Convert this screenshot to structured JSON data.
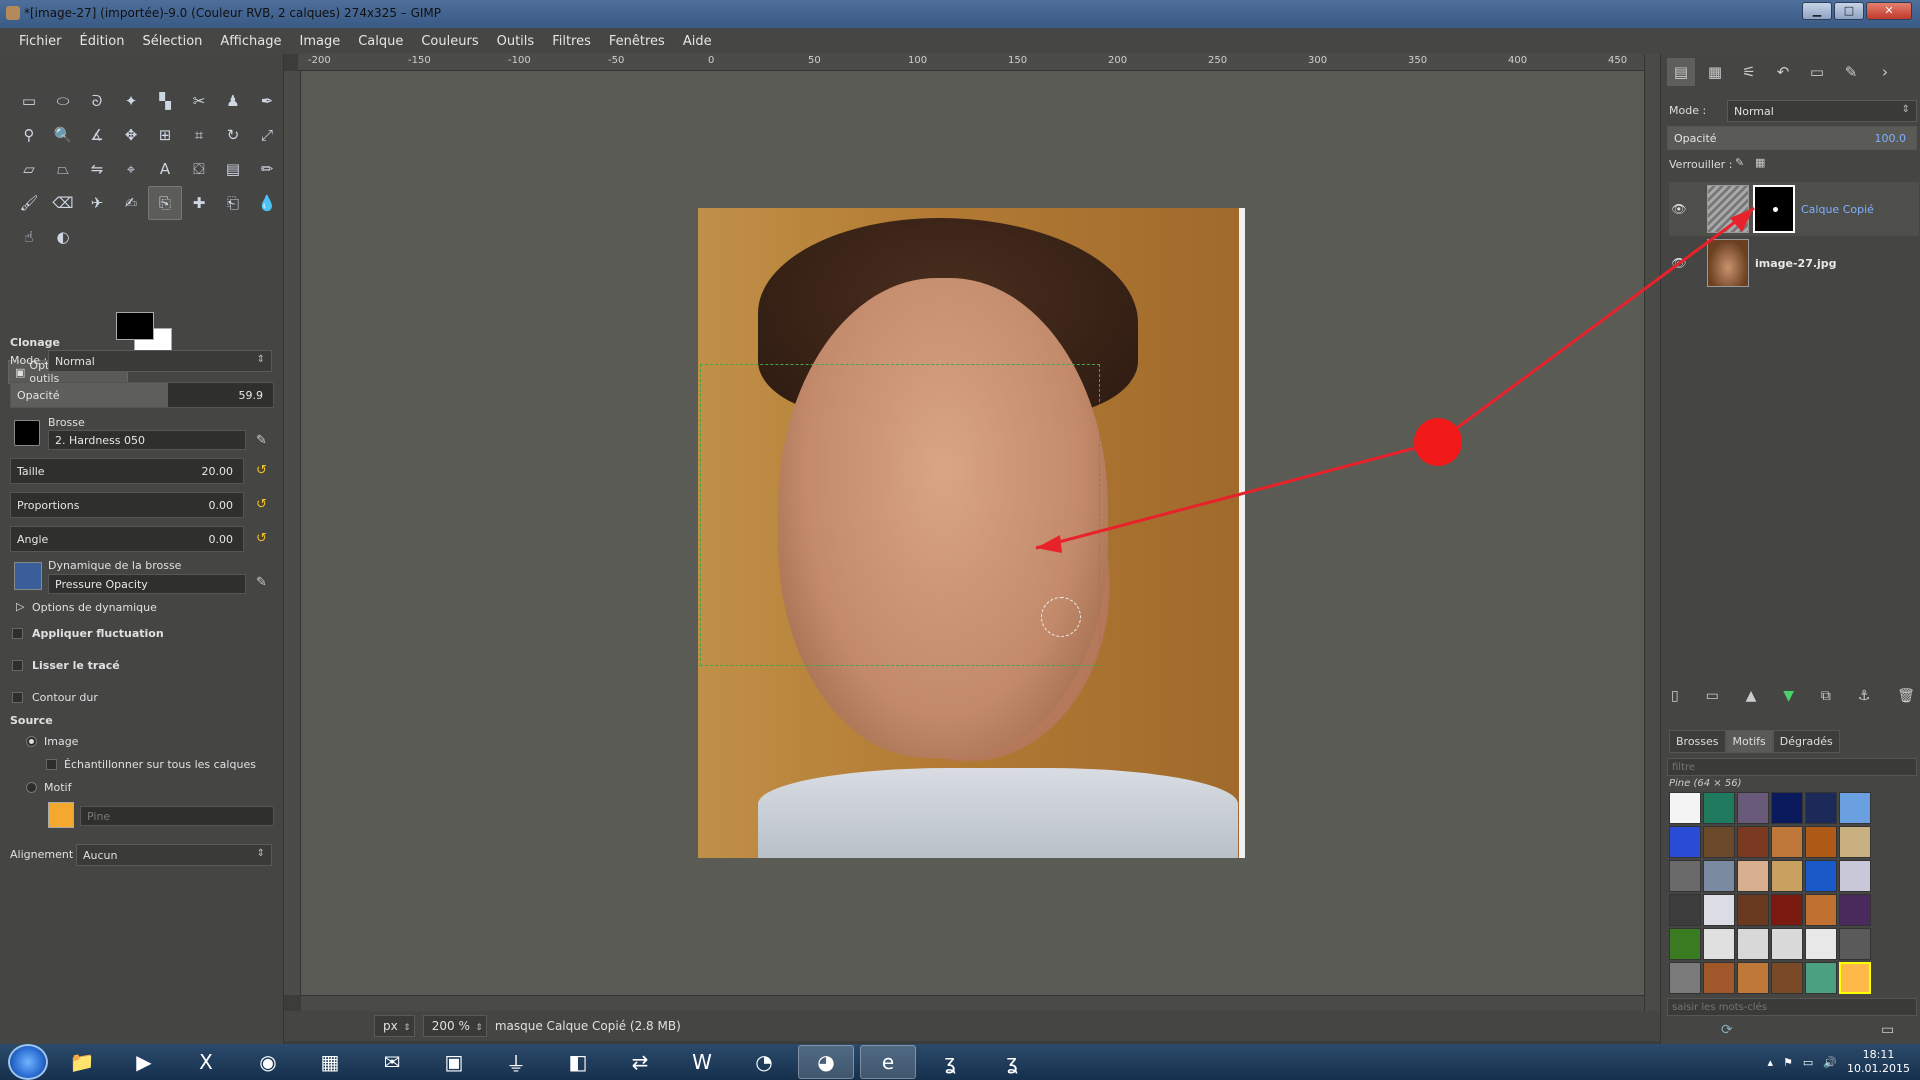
{
  "window": {
    "title": "*[image-27] (importée)-9.0 (Couleur RVB, 2 calques) 274x325 – GIMP",
    "minimize_label": "▁",
    "maximize_label": "□",
    "close_label": "✕"
  },
  "menu": [
    "Fichier",
    "Édition",
    "Sélection",
    "Affichage",
    "Image",
    "Calque",
    "Couleurs",
    "Outils",
    "Filtres",
    "Fenêtres",
    "Aide"
  ],
  "ruler_labels": [
    "-200",
    "-150",
    "-100",
    "-50",
    "0",
    "50",
    "100",
    "150",
    "200",
    "250",
    "300",
    "350",
    "400",
    "450"
  ],
  "tool_options": {
    "tab_label": "Options des outils",
    "tool_name": "Clonage",
    "mode_label": "Mode :",
    "mode_value": "Normal",
    "opacity_label": "Opacité",
    "opacity_value": "59.9",
    "opacity_fraction": 0.599,
    "brush_label": "Brosse",
    "brush_value": "2. Hardness 050",
    "size_label": "Taille",
    "size_value": "20.00",
    "proportions_label": "Proportions",
    "proportions_value": "0.00",
    "angle_label": "Angle",
    "angle_value": "0.00",
    "dynamics_label": "Dynamique de la brosse",
    "dynamics_value": "Pressure Opacity",
    "dynamics_options": "Options de dynamique",
    "apply_jitter": "Appliquer fluctuation",
    "smooth_stroke": "Lisser le tracé",
    "hard_edge": "Contour dur",
    "source_label": "Source",
    "source_image": "Image",
    "sample_merged": "Échantillonner sur tous les calques",
    "source_pattern": "Motif",
    "pattern_name": "Pine",
    "alignment_label": "Alignement :",
    "alignment_value": "Aucun"
  },
  "status": {
    "unit": "px",
    "zoom": "200 %",
    "message": "masque Calque Copié (2.8 MB)"
  },
  "layers_panel": {
    "mode_label": "Mode :",
    "mode_value": "Normal",
    "opacity_label": "Opacité",
    "opacity_value": "100.0",
    "lock_label": "Verrouiller :",
    "layers": [
      {
        "name": "Calque Copié"
      },
      {
        "name": "image-27.jpg"
      }
    ]
  },
  "resources": {
    "tabs": [
      "Brosses",
      "Motifs",
      "Dégradés"
    ],
    "filter_placeholder": "filtre",
    "selected_pattern": "Pine (64 × 56)",
    "tags_placeholder": "saisir les mots-clés",
    "pattern_colors": [
      "#f4f4f4",
      "#1f7a5e",
      "#6a5a7a",
      "#0b1a5c",
      "#1c2a5a",
      "#6aa0e0",
      "#2a4bd6",
      "#6b4a2c",
      "#7a3a22",
      "#c0783a",
      "#b05a18",
      "#c8b080",
      "#6a6a6a",
      "#7a8aa0",
      "#d8b090",
      "#c8a060",
      "#1a5ac8",
      "#c8c8d8",
      "#3c3c3c",
      "#dcdce4",
      "#6a3a20",
      "#7a1a10",
      "#c07030",
      "#4a2a5c",
      "#3a7a20",
      "#e0e0e0",
      "#d8d8d8",
      "#dadada",
      "#e8e8e8",
      "#5a5a5a",
      "#7a7a7a",
      "#a0582a",
      "#c07838",
      "#7a4a28",
      "#4aa080",
      "#ffb84a"
    ]
  },
  "taskbar": {
    "time": "18:11",
    "date": "10.01.2015"
  }
}
